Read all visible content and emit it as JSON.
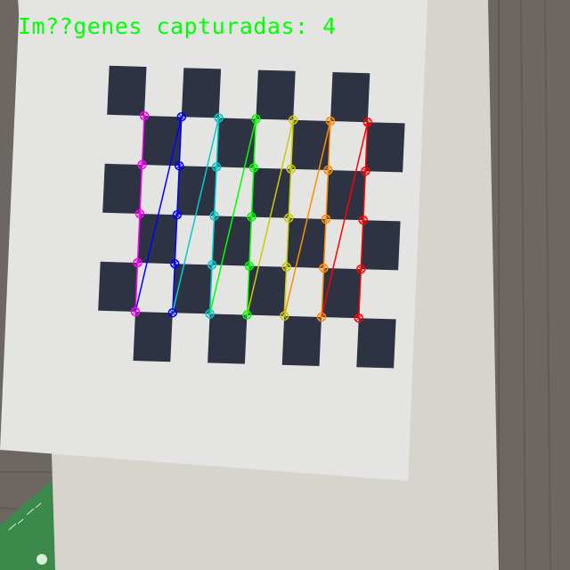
{
  "overlay": {
    "caption": "Im??genes capturadas: 4",
    "caption_color": "#00ff00"
  },
  "board": {
    "square_color": "#2e3344",
    "paper_color": "#e4e5e3"
  },
  "corner_grid": {
    "rows": 5,
    "cols": 7,
    "column_colors": [
      "#ff00ff",
      "#0000ff",
      "#00cccc",
      "#00ff00",
      "#cccc00",
      "#ff8c00",
      "#ff0000"
    ]
  },
  "icons": [
    "ruler-icon"
  ]
}
